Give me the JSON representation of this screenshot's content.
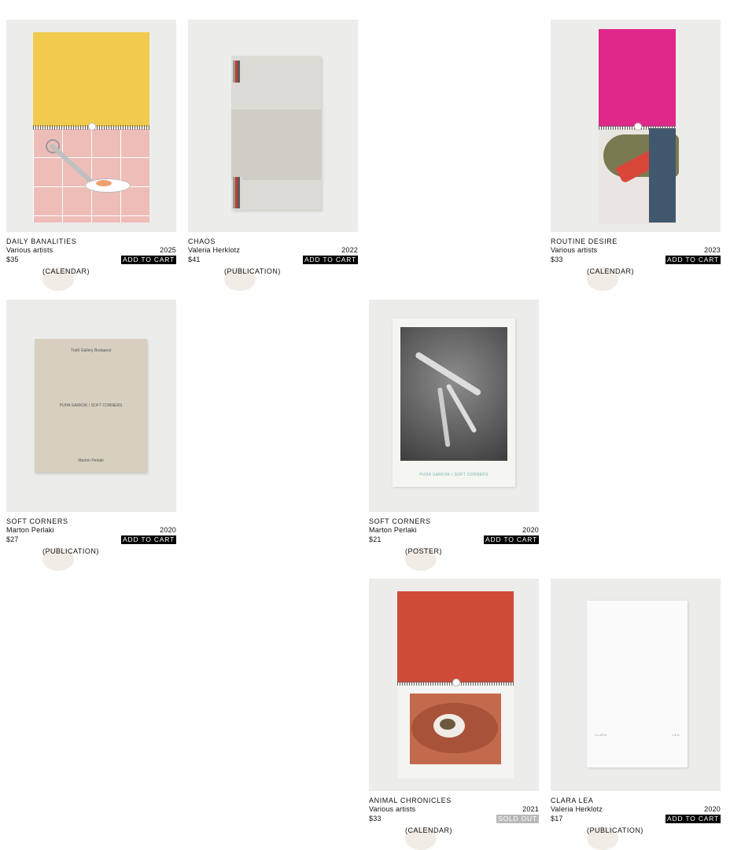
{
  "products": [
    {
      "id": "daily-banalities",
      "title": "DAILY BANALITIES",
      "category": "(CALENDAR)",
      "author": "Various artists",
      "year": "2025",
      "price": "$35",
      "action": "ADD TO CART",
      "top_color": "#f2cb4e"
    },
    {
      "id": "chaos",
      "title": "CHAOS",
      "category": "(PUBLICATION)",
      "author": "Valeria Herklotz",
      "year": "2022",
      "price": "$41",
      "action": "ADD TO CART"
    },
    {
      "id": "routine-desire",
      "title": "ROUTINE DESIRE",
      "category": "(CALENDAR)",
      "author": "Various artists",
      "year": "2023",
      "price": "$33",
      "action": "ADD TO CART",
      "top_color": "#e0278a"
    },
    {
      "id": "soft-corners-publication",
      "title": "SOFT CORNERS",
      "category": "(PUBLICATION)",
      "author": "Marton Perlaki",
      "year": "2020",
      "price": "$27",
      "action": "ADD TO CART",
      "cover": {
        "line1": "Trafó Gallery Budapest",
        "line2": "PUHA SARKOK / SOFT CORNERS",
        "line3": "Marton Perlaki"
      }
    },
    {
      "id": "soft-corners-poster",
      "title": "SOFT CORNERS",
      "category": "(POSTER)",
      "author": "Marton Perlaki",
      "year": "2020",
      "price": "$21",
      "action": "ADD TO CART",
      "cover": {
        "caption": "PUHA SARKOK / SOFT CORNERS"
      }
    },
    {
      "id": "animal-chronicles",
      "title": "ANIMAL CHRONICLES",
      "category": "(CALENDAR)",
      "author": "Various artists",
      "year": "2021",
      "price": "$33",
      "action": "SOLD OUT",
      "top_color": "#cf4b38"
    },
    {
      "id": "clara-lea",
      "title": "CLARA LEA",
      "category": "(PUBLICATION)",
      "author": "Valeria Herklotz",
      "year": "2020",
      "price": "$17",
      "action": "ADD TO CART",
      "cover": {
        "words": [
          "CLARA",
          "·",
          "·",
          "LEA"
        ]
      }
    }
  ]
}
